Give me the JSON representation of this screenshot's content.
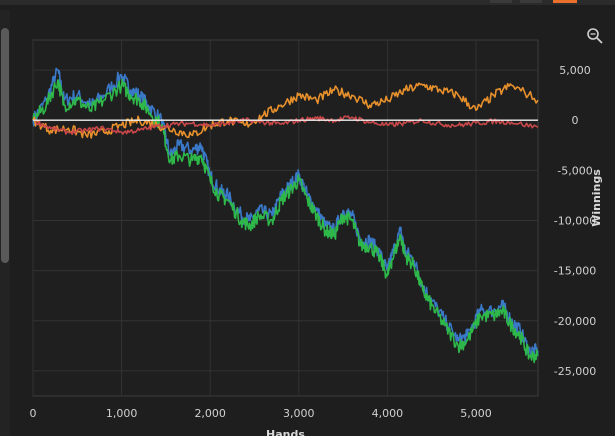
{
  "chart_data": {
    "type": "line",
    "xlabel": "Hands",
    "ylabel": "Winnings",
    "xlim": [
      0,
      5700
    ],
    "ylim": [
      -27500,
      8000
    ],
    "xticks": [
      0,
      1000,
      2000,
      3000,
      4000,
      5000
    ],
    "xtick_labels": [
      "0",
      "1,000",
      "2,000",
      "3,000",
      "4,000",
      "5,000"
    ],
    "yticks": [
      5000,
      0,
      -5000,
      -10000,
      -15000,
      -20000,
      -25000
    ],
    "ytick_labels": [
      "5,000",
      "0",
      "-5,000",
      "-10,000",
      "-15,000",
      "-20,000",
      "-25,000"
    ],
    "grid": true,
    "zero_line": true,
    "series": [
      {
        "color": "#3a78c8",
        "x": [
          0,
          150,
          280,
          350,
          500,
          650,
          800,
          1000,
          1100,
          1200,
          1300,
          1450,
          1550,
          1650,
          1800,
          1900,
          2000,
          2100,
          2200,
          2350,
          2450,
          2550,
          2700,
          2800,
          2900,
          3000,
          3100,
          3200,
          3300,
          3400,
          3500,
          3600,
          3700,
          3800,
          3900,
          4000,
          4050,
          4150,
          4200,
          4300,
          4400,
          4500,
          4650,
          4800,
          4900,
          5050,
          5200,
          5300,
          5400,
          5500,
          5600,
          5700
        ],
        "y": [
          0,
          2000,
          5000,
          2000,
          2500,
          1500,
          2500,
          4500,
          3000,
          2500,
          1500,
          0,
          -3500,
          -2500,
          -3000,
          -2500,
          -5500,
          -7000,
          -7500,
          -9500,
          -10000,
          -9000,
          -9500,
          -7500,
          -6500,
          -5500,
          -7500,
          -9000,
          -10500,
          -11000,
          -9000,
          -9500,
          -12000,
          -12000,
          -13000,
          -15000,
          -13500,
          -11000,
          -13000,
          -14000,
          -16500,
          -18000,
          -20000,
          -22000,
          -21500,
          -19000,
          -19000,
          -18500,
          -20000,
          -21000,
          -23000,
          -23000
        ]
      },
      {
        "color": "#2fb84a",
        "x": [
          0,
          150,
          280,
          350,
          500,
          650,
          800,
          1000,
          1100,
          1200,
          1300,
          1450,
          1550,
          1650,
          1800,
          1900,
          2000,
          2100,
          2200,
          2350,
          2450,
          2550,
          2700,
          2800,
          2900,
          3000,
          3100,
          3200,
          3300,
          3400,
          3500,
          3600,
          3700,
          3800,
          3900,
          4000,
          4050,
          4150,
          4200,
          4300,
          4400,
          4500,
          4650,
          4800,
          4900,
          5050,
          5200,
          5300,
          5400,
          5500,
          5600,
          5700
        ],
        "y": [
          0,
          1500,
          4000,
          1500,
          2000,
          1000,
          2000,
          3500,
          2500,
          2000,
          1000,
          -500,
          -4000,
          -3500,
          -4000,
          -3500,
          -6000,
          -7500,
          -8000,
          -10000,
          -10500,
          -9500,
          -10000,
          -8000,
          -7000,
          -6000,
          -8000,
          -9500,
          -11000,
          -11500,
          -9500,
          -10000,
          -12500,
          -12500,
          -13500,
          -15500,
          -14000,
          -11500,
          -13500,
          -14500,
          -17000,
          -18500,
          -20500,
          -22500,
          -22000,
          -19500,
          -19500,
          -19000,
          -20500,
          -21500,
          -23500,
          -23500
        ]
      },
      {
        "color": "#e8912c",
        "x": [
          0,
          200,
          400,
          600,
          800,
          1000,
          1200,
          1400,
          1600,
          1800,
          2000,
          2200,
          2400,
          2600,
          2800,
          3000,
          3200,
          3400,
          3600,
          3800,
          4000,
          4200,
          4400,
          4600,
          4800,
          5000,
          5200,
          5400,
          5700
        ],
        "y": [
          0,
          -1000,
          -800,
          -1500,
          -1200,
          -500,
          0,
          -500,
          -1000,
          -1500,
          -500,
          0,
          -500,
          500,
          1500,
          2500,
          2000,
          3000,
          2500,
          1500,
          2000,
          3000,
          3500,
          3000,
          2500,
          1000,
          2500,
          3500,
          2000
        ]
      },
      {
        "color": "#c9484a",
        "x": [
          0,
          200,
          400,
          600,
          800,
          1000,
          1200,
          1400,
          1600,
          1800,
          2000,
          2200,
          2400,
          2600,
          2800,
          3000,
          3200,
          3400,
          3600,
          3800,
          4000,
          4200,
          4400,
          4600,
          4800,
          5000,
          5200,
          5400,
          5700
        ],
        "y": [
          0,
          -800,
          -1200,
          -1000,
          -800,
          -1200,
          -1000,
          -600,
          -400,
          -300,
          -500,
          -300,
          0,
          -200,
          -400,
          0,
          200,
          0,
          300,
          -200,
          -500,
          -300,
          0,
          -400,
          -500,
          -300,
          -100,
          -200,
          -700
        ]
      }
    ]
  }
}
